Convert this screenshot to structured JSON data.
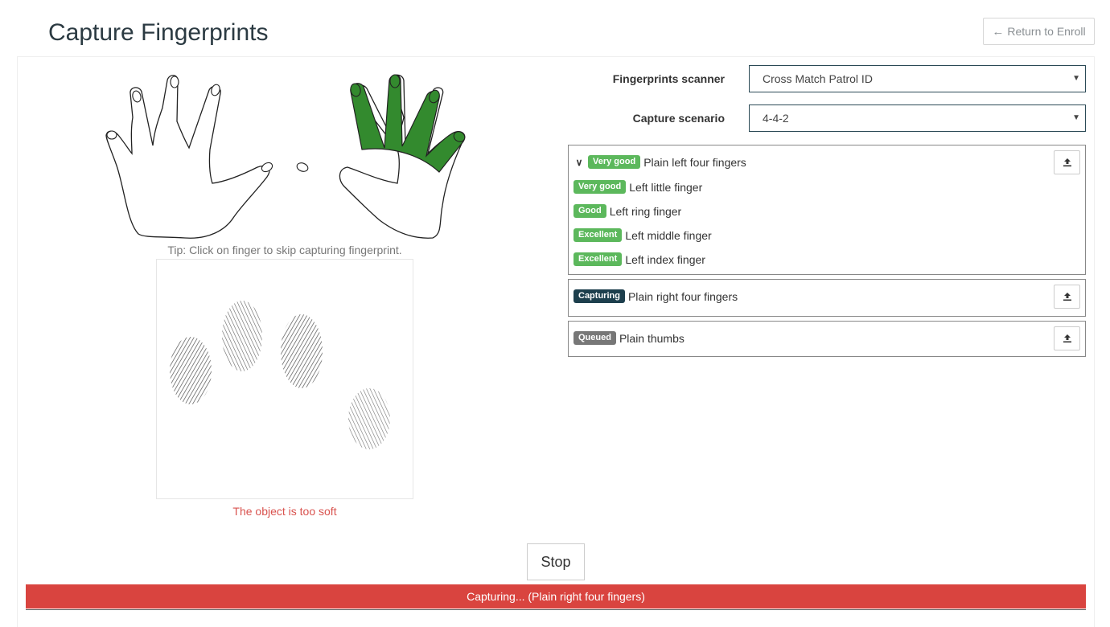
{
  "header": {
    "title": "Capture Fingerprints",
    "return_label": "Return to Enroll",
    "return_icon": "arrow-left-icon"
  },
  "capture": {
    "tip": "Tip: Click on finger to skip capturing fingerprint.",
    "message": "The object is too soft"
  },
  "form": {
    "scanner_label": "Fingerprints scanner",
    "scanner_value": "Cross Match Patrol ID",
    "scenario_label": "Capture scenario",
    "scenario_value": "4-4-2"
  },
  "groups": [
    {
      "status": "Very good",
      "title": "Plain left four fingers",
      "expanded": true,
      "fingers": [
        {
          "status": "Very good",
          "name": "Left little finger"
        },
        {
          "status": "Good",
          "name": "Left ring finger"
        },
        {
          "status": "Excellent",
          "name": "Left middle finger"
        },
        {
          "status": "Excellent",
          "name": "Left index finger"
        }
      ]
    },
    {
      "status": "Capturing",
      "title": "Plain right four fingers"
    },
    {
      "status": "Queued",
      "title": "Plain thumbs"
    }
  ],
  "actions": {
    "stop_label": "Stop"
  },
  "status_bar": {
    "text": "Capturing... (Plain right four fingers)"
  },
  "colors": {
    "finger_highlight": "#338a2e",
    "badge_green": "#5cb85c",
    "badge_capturing": "#1d3f4d",
    "badge_queued": "#777777",
    "status_bar": "#d9443f",
    "error_text": "#d9534f"
  }
}
